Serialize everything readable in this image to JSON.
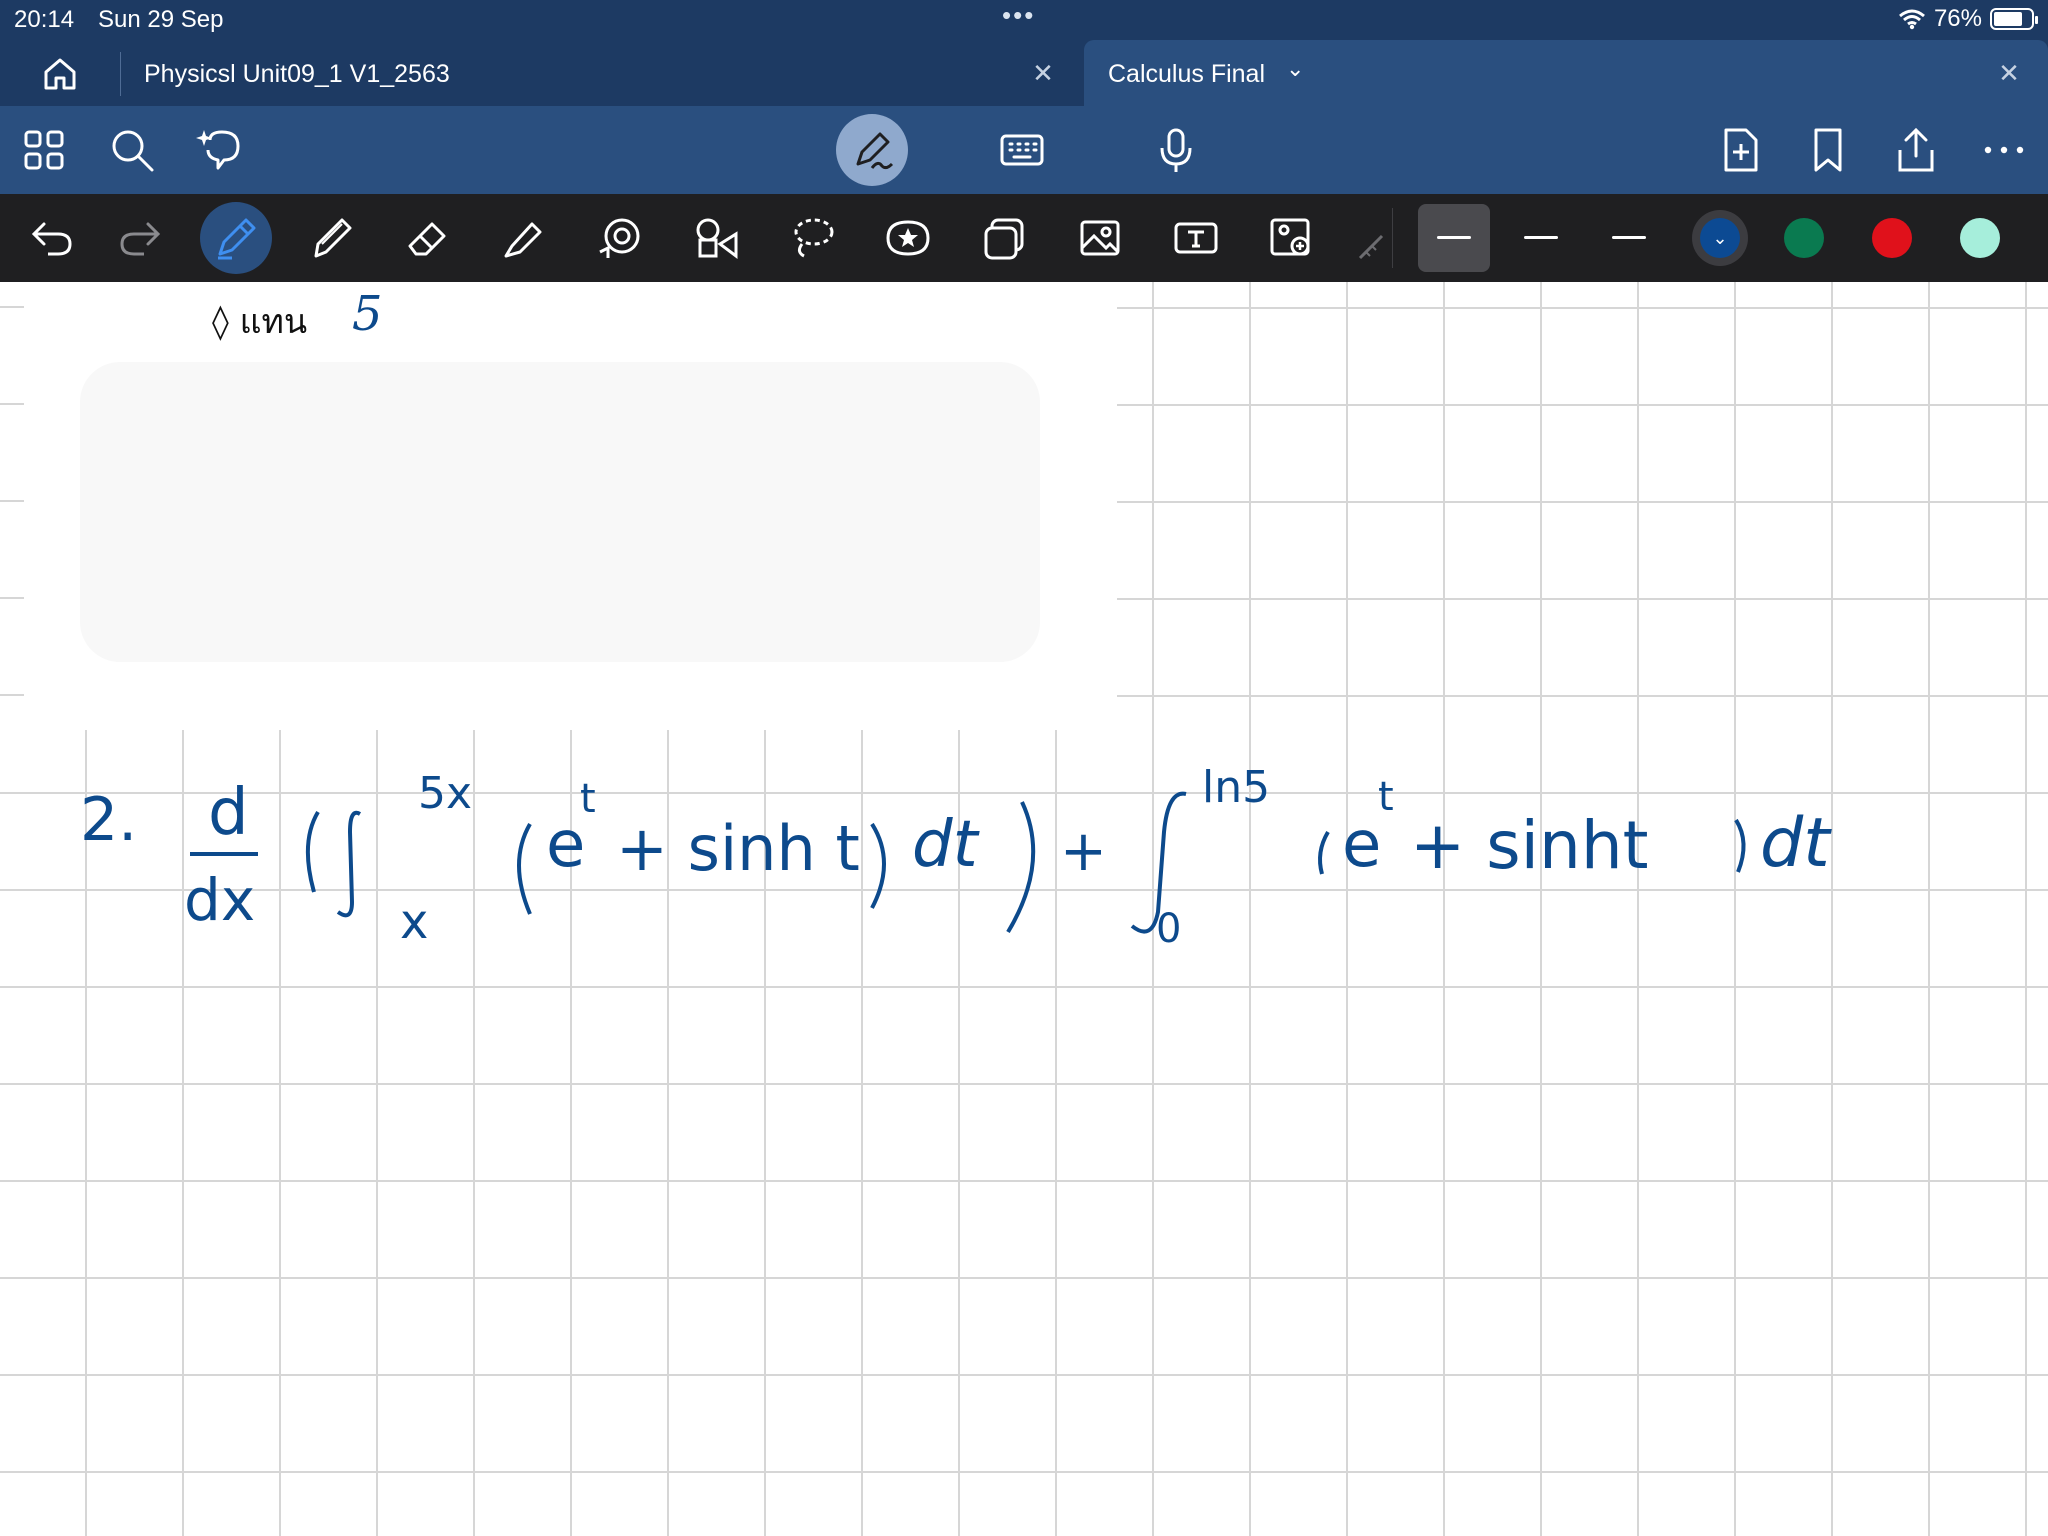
{
  "status": {
    "time": "20:14",
    "date": "Sun 29 Sep",
    "battery": "76%"
  },
  "tabs": [
    {
      "label": "Physicsl Unit09_1 V1_2563"
    },
    {
      "label": "Calculus Final"
    }
  ],
  "colors": {
    "ink": "#0d4a8c",
    "swatches": [
      "#0c4a93",
      "#0a7a50",
      "#e0111b",
      "#a6eedb"
    ]
  },
  "page": {
    "bullet": "◊ แทน",
    "value": "5",
    "problem_number": "2.",
    "equation": "d/dx ( ∫_x^{5x} (e^t + sinh t) dt ) + ∫_0^{ln5} (e^t + sinh t) dt",
    "ink": {
      "d_num": "d",
      "d_den": "dx",
      "lower1": "x",
      "upper1": "5x",
      "e1": "e",
      "t_sup1": "t",
      "sinh1": "+ sinh t",
      "dt1": "dt",
      "plus": "+",
      "lower2": "0",
      "upper2": "ln5",
      "e2": "e",
      "t_sup2": "t",
      "sinh2": "+ sinht",
      "dt2": "dt"
    }
  }
}
